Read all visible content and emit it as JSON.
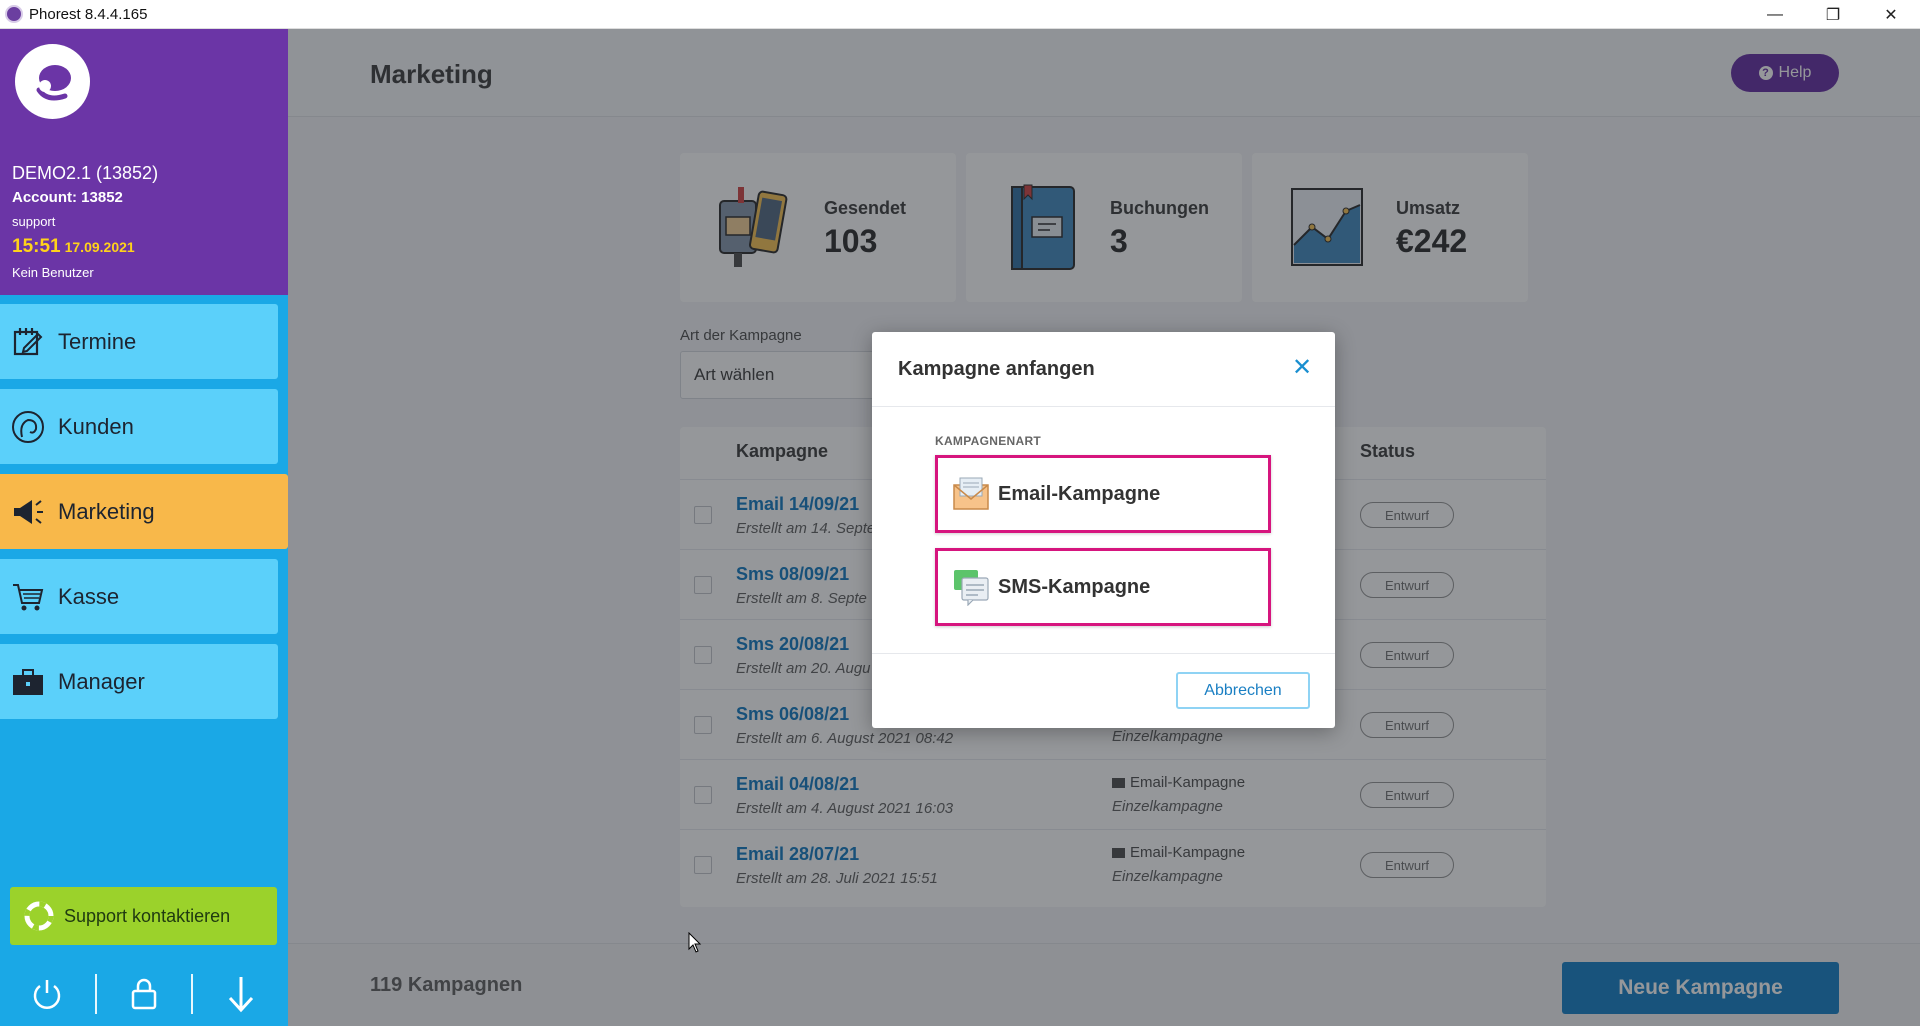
{
  "window": {
    "title": "Phorest 8.4.4.165",
    "minimize": "—",
    "restore": "❐",
    "close": "✕"
  },
  "account": {
    "name": "DEMO2.1 (13852)",
    "account": "Account: 13852",
    "user": "support",
    "time": "15:51",
    "date": "17.09.2021",
    "status": "Kein Benutzer"
  },
  "nav": {
    "items": [
      {
        "label": "Termine",
        "icon": "calendar-edit-icon"
      },
      {
        "label": "Kunden",
        "icon": "customer-head-icon"
      },
      {
        "label": "Marketing",
        "icon": "megaphone-icon"
      },
      {
        "label": "Kasse",
        "icon": "shopping-cart-icon"
      },
      {
        "label": "Manager",
        "icon": "briefcase-icon"
      }
    ]
  },
  "support": {
    "label": "Support kontaktieren"
  },
  "header": {
    "title": "Marketing",
    "help": "Help"
  },
  "stats": [
    {
      "label": "Gesendet",
      "value": "103"
    },
    {
      "label": "Buchungen",
      "value": "3"
    },
    {
      "label": "Umsatz",
      "value": "€242"
    }
  ],
  "filter": {
    "label": "Art der Kampagne",
    "value": "Art wählen"
  },
  "table": {
    "headers": {
      "campaign": "Kampagne",
      "status": "Status"
    },
    "rows": [
      {
        "name": "Email 14/09/21",
        "date": "Erstellt am 14. Septe",
        "type": "",
        "sub": "",
        "status": "Entwurf"
      },
      {
        "name": "Sms 08/09/21",
        "date": "Erstellt am 8. Septe",
        "type": "",
        "sub": "",
        "status": "Entwurf"
      },
      {
        "name": "Sms 20/08/21",
        "date": "Erstellt am 20. Augu",
        "type": "",
        "sub": "",
        "status": "Entwurf"
      },
      {
        "name": "Sms 06/08/21",
        "date": "Erstellt am 6. August 2021 08:42",
        "type": "",
        "sub": "Einzelkampagne",
        "status": "Entwurf"
      },
      {
        "name": "Email 04/08/21",
        "date": "Erstellt am 4. August 2021 16:03",
        "type": "Email-Kampagne",
        "sub": "Einzelkampagne",
        "status": "Entwurf"
      },
      {
        "name": "Email 28/07/21",
        "date": "Erstellt am 28. Juli 2021 15:51",
        "type": "Email-Kampagne",
        "sub": "Einzelkampagne",
        "status": "Entwurf"
      }
    ]
  },
  "footer": {
    "count": "119 Kampagnen",
    "new_button": "Neue Kampagne"
  },
  "modal": {
    "title": "Kampagne anfangen",
    "close": "✕",
    "section": "KAMPAGNENART",
    "options": [
      {
        "label": "Email-Kampagne",
        "icon": "email-envelope-icon"
      },
      {
        "label": "SMS-Kampagne",
        "icon": "sms-chat-icon"
      }
    ],
    "cancel": "Abbrechen"
  },
  "colors": {
    "sidebar": "#1aa8e6",
    "account_bg": "#6b35a6",
    "nav_active": "#f8b84a",
    "support": "#9bd22b",
    "highlight": "#d6157e",
    "primary": "#1d84c8"
  }
}
